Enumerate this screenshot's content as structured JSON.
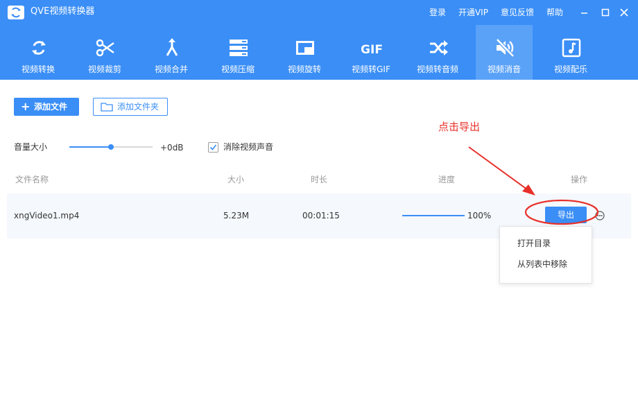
{
  "window": {
    "title": "QVE视频转换器",
    "links": [
      "登录",
      "开通VIP",
      "意见反馈",
      "帮助"
    ]
  },
  "toolbar": {
    "active_index": 7,
    "items": [
      {
        "label": "视频转换",
        "icon": "sync-icon"
      },
      {
        "label": "视频裁剪",
        "icon": "scissors-icon"
      },
      {
        "label": "视频合并",
        "icon": "merge-icon"
      },
      {
        "label": "视频压缩",
        "icon": "compress-icon"
      },
      {
        "label": "视频旋转",
        "icon": "rotate-icon"
      },
      {
        "label": "视频转GIF",
        "icon": "gif-icon"
      },
      {
        "label": "视频转音频",
        "icon": "shuffle-icon"
      },
      {
        "label": "视频消音",
        "icon": "mute-icon"
      },
      {
        "label": "视频配乐",
        "icon": "music-icon"
      }
    ]
  },
  "actions": {
    "add_file": "添加文件",
    "add_folder": "添加文件夹"
  },
  "volume": {
    "label": "音量大小",
    "value_text": "+0dB",
    "level_fraction": 0.5
  },
  "mute": {
    "label": "消除视频声音",
    "checked": true
  },
  "table": {
    "headers": {
      "name": "文件名称",
      "size": "大小",
      "duration": "时长",
      "progress": "进度",
      "operation": "操作"
    },
    "rows": [
      {
        "name": "xngVideo1.mp4",
        "size": "5.23M",
        "duration": "00:01:15",
        "progress_text": "100%",
        "progress_percent": 100,
        "export_label": "导出"
      }
    ]
  },
  "context_menu": {
    "items": [
      "打开目录",
      "从列表中移除"
    ]
  },
  "annotation": {
    "text": "点击导出",
    "color": "#e8302a"
  },
  "colors": {
    "accent": "#3a8ef6",
    "active_tab": "#5aa2f8"
  }
}
